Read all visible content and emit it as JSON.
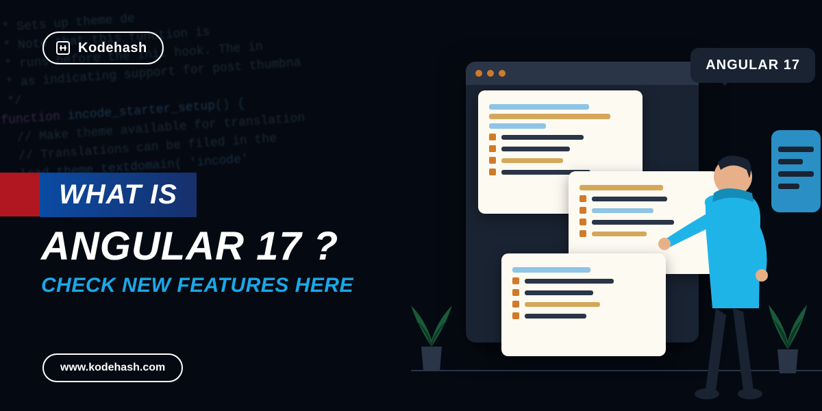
{
  "logo": {
    "brand": "Kodehash"
  },
  "headline": {
    "badge": "WHAT IS",
    "main": "ANGULAR 17 ?",
    "sub": "CHECK NEW FEATURES HERE"
  },
  "url": "www.kodehash.com",
  "speech": "ANGULAR 17",
  "bg_code": {
    "l1": "   * Sets up theme de",
    "l2": "   * Note that this function is ",
    "l3": "   * runs before the init hook. The in",
    "l4": "   * as indicating support for post thumbna",
    "l5": "   */",
    "l6": "  function incode_starter_setup() {",
    "l7": "    // Make theme available for translation",
    "l8": "    // Translations can be filed in the",
    "l9": "    load_theme_textdomain( 'incode'"
  }
}
